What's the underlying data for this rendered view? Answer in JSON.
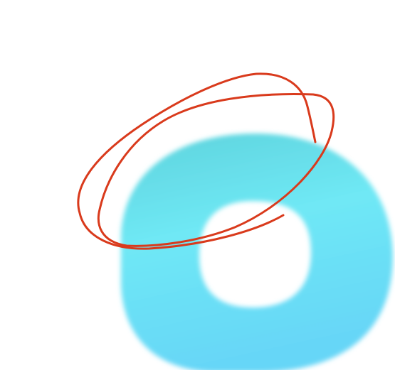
{
  "colors": {
    "background": "#ffffff",
    "ring_top": "#5ed3dc",
    "ring_mid": "#6fe8f5",
    "ring_bottom": "#66d6f7",
    "scribble": "#d93a1c"
  },
  "ring": {
    "shape": "rounded-square-ring",
    "style": "blurred",
    "description_icon": "circle-ring-icon"
  },
  "annotation": {
    "type": "freehand-ellipse-scribble",
    "icon": "red-loop-scribble"
  }
}
